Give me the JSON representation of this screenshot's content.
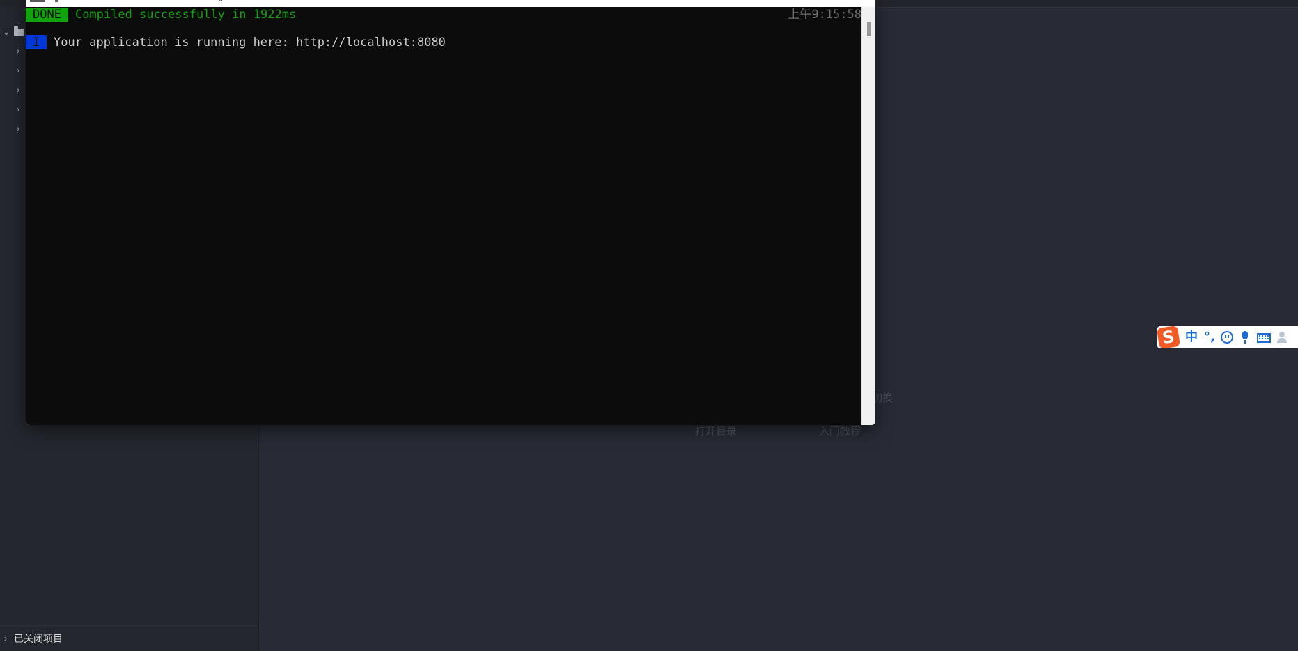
{
  "terminal": {
    "title_icon": "window-icon",
    "done_badge": "DONE",
    "done_message": "Compiled successfully in 1922ms",
    "timestamp": "上午9:15:58",
    "info_badge": "I",
    "info_message": "Your application is running here: http://localhost:8080"
  },
  "sidebar": {
    "root_icon": "folder-icon",
    "child_count": 5,
    "closed_projects_label": "已关闭项目"
  },
  "welcome": {
    "open_directory": "打开目录",
    "getting_started": "入门教程",
    "switch_partial": "切换"
  },
  "ime": {
    "logo": "S",
    "mode": "中",
    "punct": "°,",
    "icons": [
      "smile-icon",
      "mic-icon",
      "keyboard-icon",
      "user-icon"
    ]
  },
  "colors": {
    "terminal_bg": "#0c0c0c",
    "done_green": "#13a10e",
    "info_blue": "#0037da",
    "ide_bg": "#282b35",
    "ime_blue": "#1e6ad6",
    "ime_orange": "#f05a24"
  }
}
